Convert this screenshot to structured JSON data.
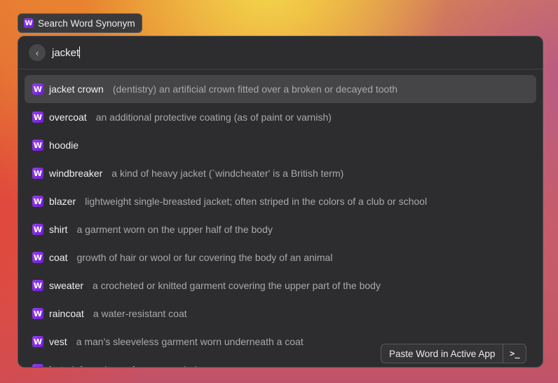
{
  "extension": {
    "title": "Search Word Synonym",
    "icon": "w-logo-icon"
  },
  "search": {
    "query": "jacket",
    "back_icon": "chevron-left-icon"
  },
  "results": [
    {
      "word": "jacket crown",
      "definition": "(dentistry) an artificial crown fitted over a broken or decayed tooth",
      "selected": true
    },
    {
      "word": "overcoat",
      "definition": "an additional protective coating (as of paint or varnish)"
    },
    {
      "word": "hoodie",
      "definition": ""
    },
    {
      "word": "windbreaker",
      "definition": "a kind of heavy jacket (`windcheater' is a British term)"
    },
    {
      "word": "blazer",
      "definition": "lightweight single-breasted jacket; often striped in the colors of a club or school"
    },
    {
      "word": "shirt",
      "definition": "a garment worn on the upper half of the body"
    },
    {
      "word": "coat",
      "definition": "growth of hair or wool or fur covering the body of an animal"
    },
    {
      "word": "sweater",
      "definition": "a crocheted or knitted garment covering the upper part of the body"
    },
    {
      "word": "raincoat",
      "definition": "a water-resistant coat"
    },
    {
      "word": "vest",
      "definition": "a man's sleeveless garment worn underneath a coat"
    },
    {
      "word": "bat",
      "definition": "informal term for a young lady"
    }
  ],
  "actions": {
    "primary_label": "Paste Word in Active App",
    "more_glyph": ">_"
  },
  "colors": {
    "icon_purple": "#8a2be2",
    "selected_row": "#454548",
    "panel": "#2d2d2f"
  }
}
